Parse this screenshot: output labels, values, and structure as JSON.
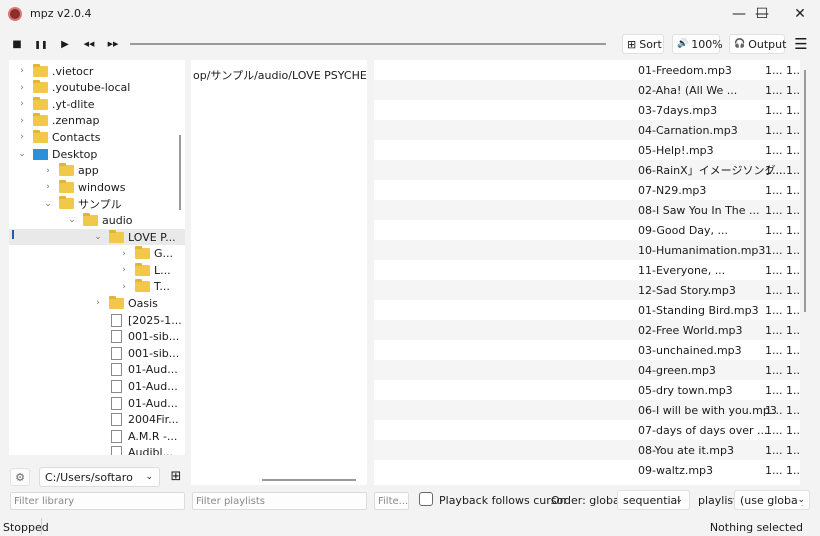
{
  "window": {
    "title": "mpz v2.0.4",
    "controls": [
      "—",
      "☐",
      "✕"
    ]
  },
  "toolbar": {
    "stop_icon": "■",
    "pause_icon": "❚❚",
    "play_icon": "▶",
    "prev_icon": "◀◀",
    "next_icon": "▶▶",
    "sort_icon": "⊞",
    "sort_label": "Sort",
    "volume_icon": "🔊",
    "volume_label": "100%",
    "output_icon": "🎧",
    "output_label": "Output",
    "menu_icon": "☰"
  },
  "library": {
    "items": [
      {
        "label": ".vietocr",
        "type": "folder",
        "chev": "›"
      },
      {
        "label": ".youtube-local",
        "type": "folder",
        "chev": "›"
      },
      {
        "label": ".yt-dlite",
        "type": "folder",
        "chev": "›"
      },
      {
        "label": ".zenmap",
        "type": "folder",
        "chev": "›"
      },
      {
        "label": "Contacts",
        "type": "folder",
        "chev": "›"
      },
      {
        "label": "Desktop",
        "type": "desktop",
        "chev": "⌄"
      },
      {
        "label": "app",
        "type": "folder",
        "chev": "›"
      },
      {
        "label": "windows",
        "type": "folder",
        "chev": "›"
      },
      {
        "label": "サンプル",
        "type": "folder",
        "chev": "⌄"
      },
      {
        "label": "audio",
        "type": "folder",
        "chev": "⌄"
      },
      {
        "label": "LOVE P...",
        "type": "folder",
        "chev": "⌄"
      },
      {
        "label": "G...",
        "type": "folder",
        "chev": "›"
      },
      {
        "label": "L...",
        "type": "folder",
        "chev": "›"
      },
      {
        "label": "T...",
        "type": "folder",
        "chev": "›"
      },
      {
        "label": "Oasis",
        "type": "folder",
        "chev": "›"
      },
      {
        "label": "[2025-1...",
        "type": "file",
        "chev": ""
      },
      {
        "label": "001-sib...",
        "type": "file",
        "chev": ""
      },
      {
        "label": "001-sib...",
        "type": "file",
        "chev": ""
      },
      {
        "label": "01-Aud...",
        "type": "file",
        "chev": ""
      },
      {
        "label": "01-Aud...",
        "type": "file",
        "chev": ""
      },
      {
        "label": "01-Aud...",
        "type": "file",
        "chev": ""
      },
      {
        "label": "2004Fir...",
        "type": "file",
        "chev": ""
      },
      {
        "label": "A.M.R -...",
        "type": "file",
        "chev": ""
      },
      {
        "label": "Audibl...",
        "type": "file",
        "chev": ""
      }
    ],
    "gear_icon": "⚙",
    "path": "C:/Users/softaro",
    "dropdown_icon": "⌄",
    "grid_icon": "⊞",
    "filter_placeholder": "Filter library"
  },
  "playlists": {
    "items": [
      "op/サンプル/audio/LOVE PSYCHEDELICO"
    ],
    "filter_placeholder": "Filter playlists"
  },
  "tracks": {
    "rows": [
      {
        "title": "01-Freedom.mp3",
        "c1": "1...",
        "c2": "1..."
      },
      {
        "title": "02-Aha! (All We ...",
        "c1": "1...",
        "c2": "1..."
      },
      {
        "title": "03-7days.mp3",
        "c1": "1...",
        "c2": "1..."
      },
      {
        "title": "04-Carnation.mp3",
        "c1": "1...",
        "c2": "1..."
      },
      {
        "title": "05-Help!.mp3",
        "c1": "1...",
        "c2": "1..."
      },
      {
        "title": "06-RainX」イメージソング...",
        "c1": "1...",
        "c2": "1..."
      },
      {
        "title": "07-N29.mp3",
        "c1": "1...",
        "c2": "1..."
      },
      {
        "title": "08-I Saw You In The ...",
        "c1": "1...",
        "c2": "1..."
      },
      {
        "title": "09-Good Day, ...",
        "c1": "1...",
        "c2": "1..."
      },
      {
        "title": "10-Humanimation.mp3",
        "c1": "1...",
        "c2": "1..."
      },
      {
        "title": "11-Everyone, ...",
        "c1": "1...",
        "c2": "1..."
      },
      {
        "title": "12-Sad Story.mp3",
        "c1": "1...",
        "c2": "1..."
      },
      {
        "title": "01-Standing Bird.mp3",
        "c1": "1...",
        "c2": "1..."
      },
      {
        "title": "02-Free World.mp3",
        "c1": "1...",
        "c2": "1..."
      },
      {
        "title": "03-unchained.mp3",
        "c1": "1...",
        "c2": "1..."
      },
      {
        "title": "04-green.mp3",
        "c1": "1...",
        "c2": "1..."
      },
      {
        "title": "05-dry town.mp3",
        "c1": "1...",
        "c2": "1..."
      },
      {
        "title": "06-I will be with you.mp3",
        "c1": "1...",
        "c2": "1..."
      },
      {
        "title": "07-days of days over ...",
        "c1": "1...",
        "c2": "1..."
      },
      {
        "title": "08-You ate it.mp3",
        "c1": "1...",
        "c2": "1..."
      },
      {
        "title": "09-waltz.mp3",
        "c1": "1...",
        "c2": "1..."
      }
    ],
    "filter_placeholder": "Filte..."
  },
  "options": {
    "follow_cursor_label": "Playback follows cursor",
    "follow_cursor_checked": false,
    "order_label": "Order:  global",
    "order_value": "sequential",
    "playlist_label": "playlist",
    "playlist_order_value": "(use global)",
    "dropdown_icon": "⌄"
  },
  "status": {
    "left": "Stopped",
    "right": "Nothing selected"
  }
}
